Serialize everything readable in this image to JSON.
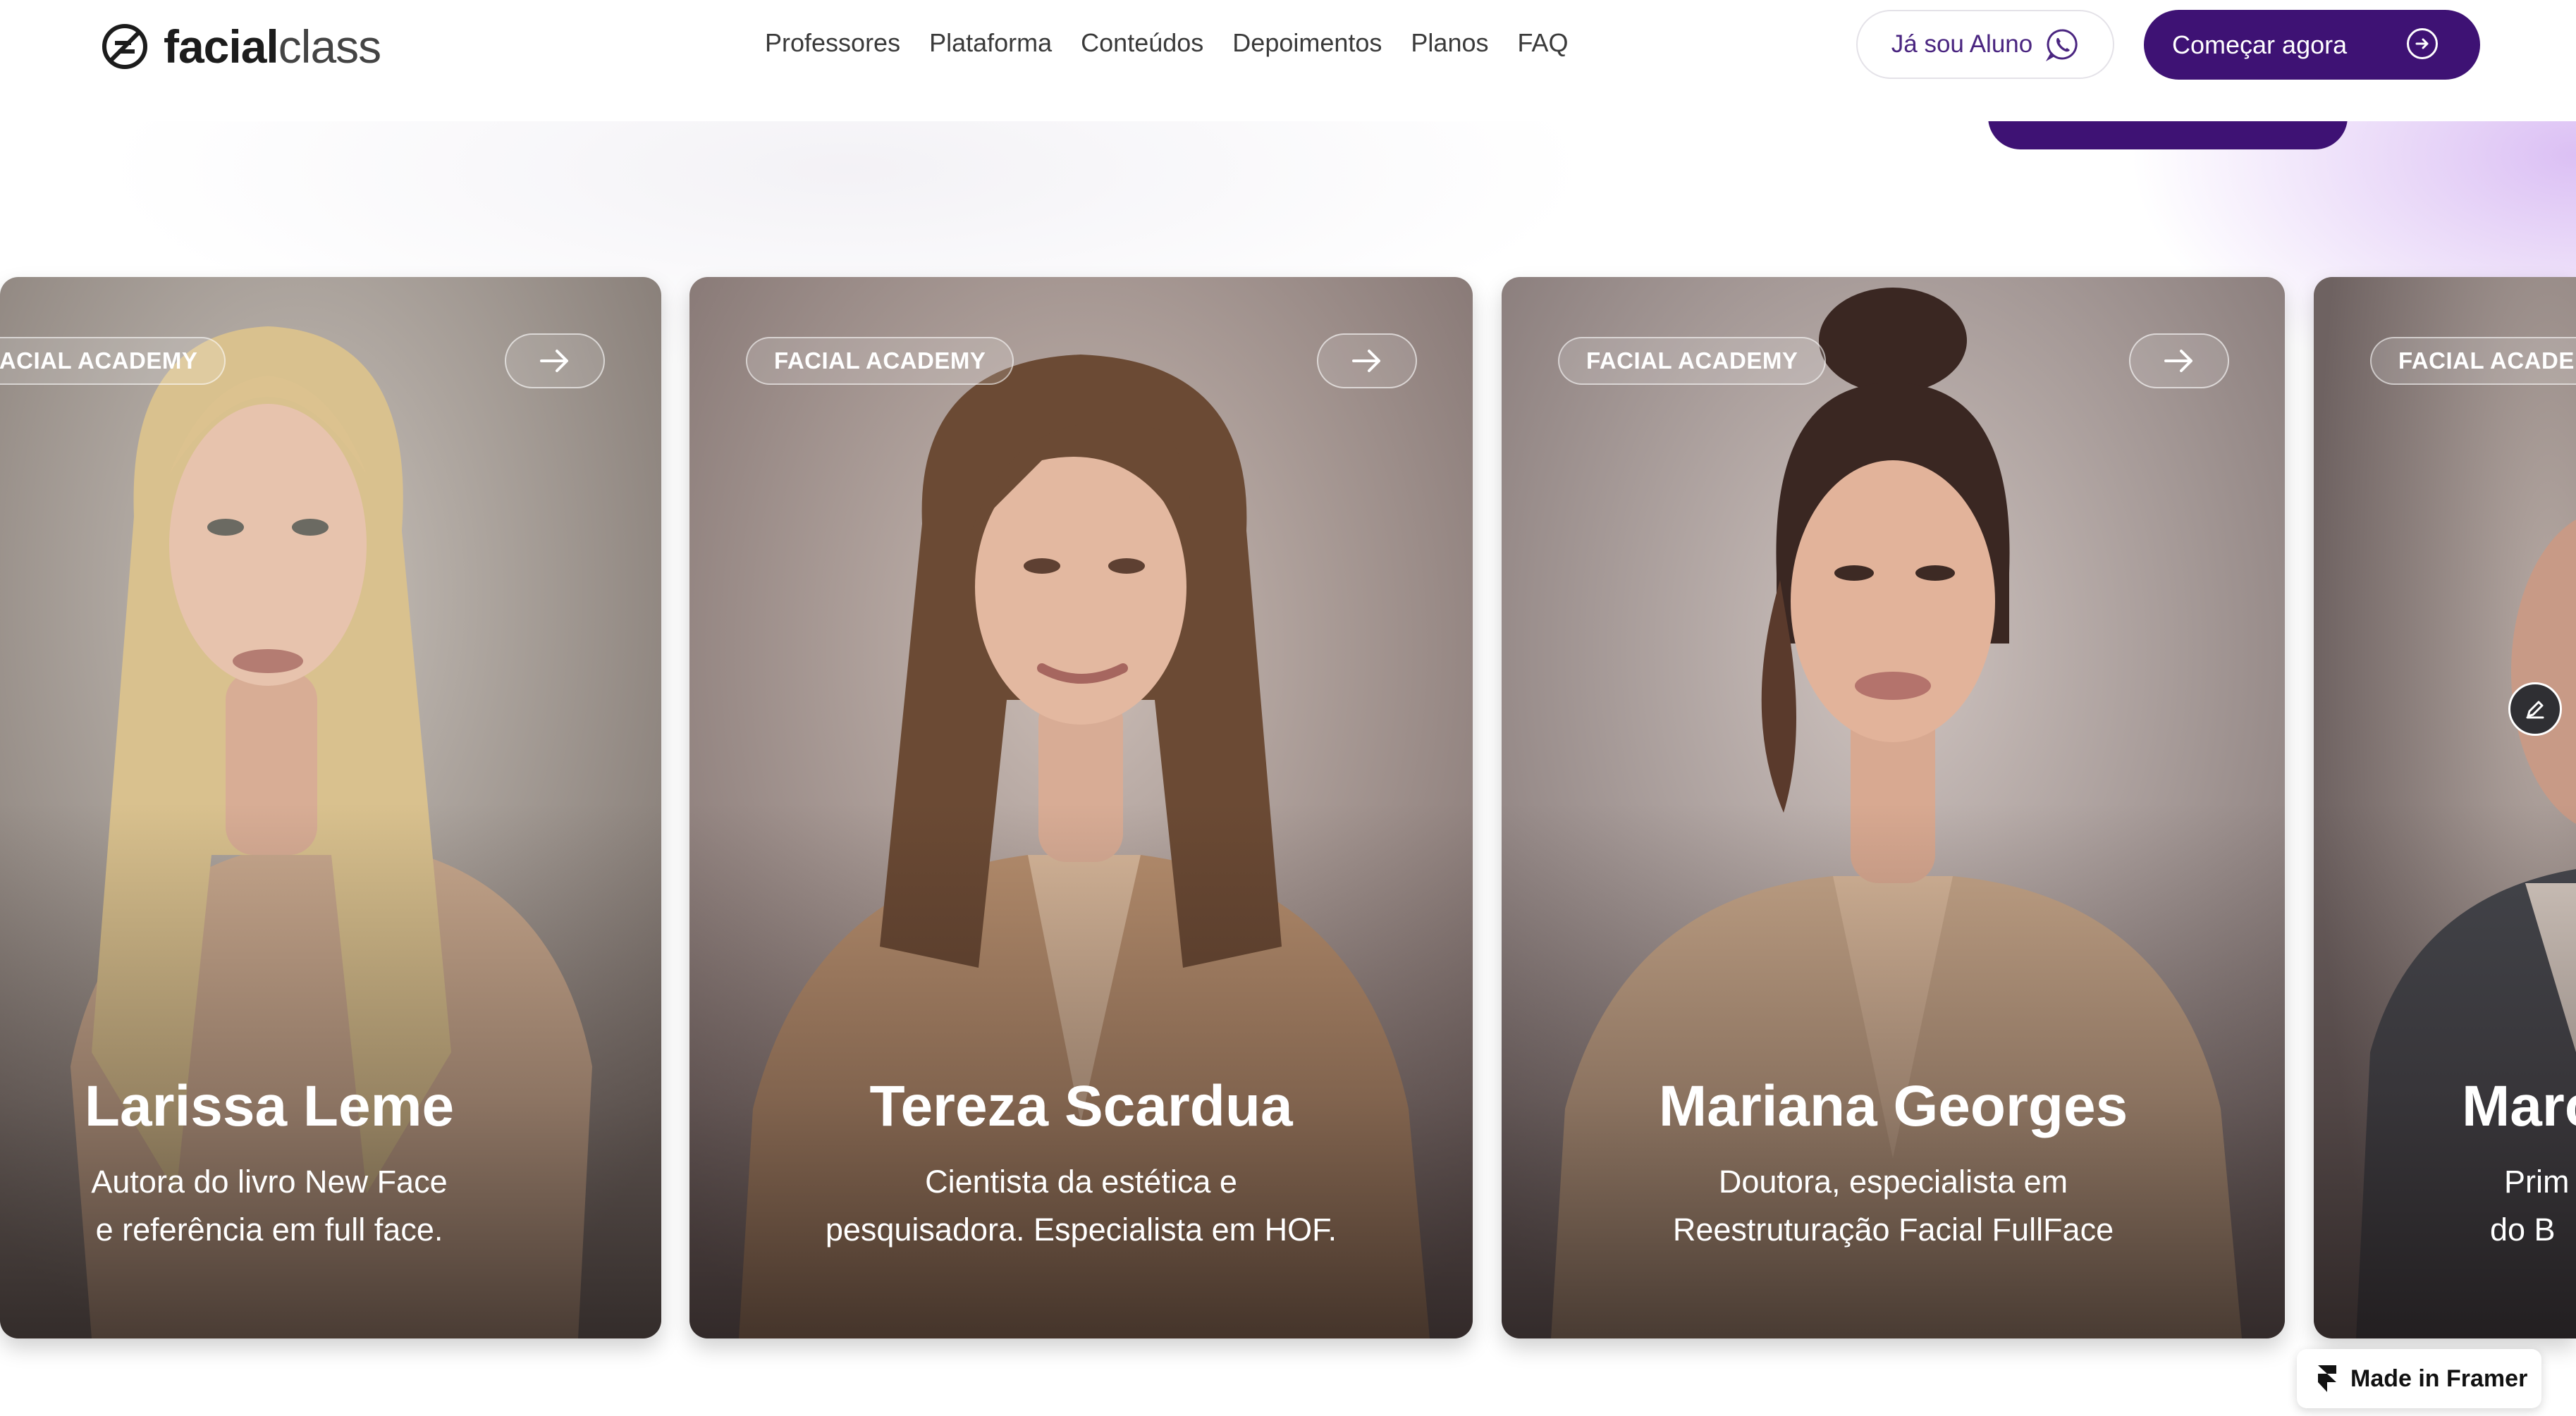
{
  "brand": {
    "bold": "facial",
    "light": "class"
  },
  "nav": {
    "links": [
      "Professores",
      "Plataforma",
      "Conteúdos",
      "Depoimentos",
      "Planos",
      "FAQ"
    ],
    "student_button": "Já sou Aluno",
    "cta_button": "Começar agora"
  },
  "cards": [
    {
      "badge": "FACIAL ACADEMY",
      "name": "Larissa Leme",
      "desc_line1": "Autora do livro New Face",
      "desc_line2": "e referência em full face."
    },
    {
      "badge": "FACIAL ACADEMY",
      "name": "Tereza Scardua",
      "desc_line1": "Cientista da estética e",
      "desc_line2": "pesquisadora. Especialista em HOF."
    },
    {
      "badge": "FACIAL ACADEMY",
      "name": "Mariana Georges",
      "desc_line1": "Doutora, especialista em",
      "desc_line2": "Reestruturação Facial FullFace"
    },
    {
      "badge": "FACIAL ACADEMY",
      "name": "Marc",
      "desc_line1": "Prim",
      "desc_line2": "do B"
    }
  ],
  "framer": {
    "label": "Made in Framer"
  },
  "colors": {
    "brand_purple": "#3e1274",
    "card_bg": "#a8998f"
  }
}
